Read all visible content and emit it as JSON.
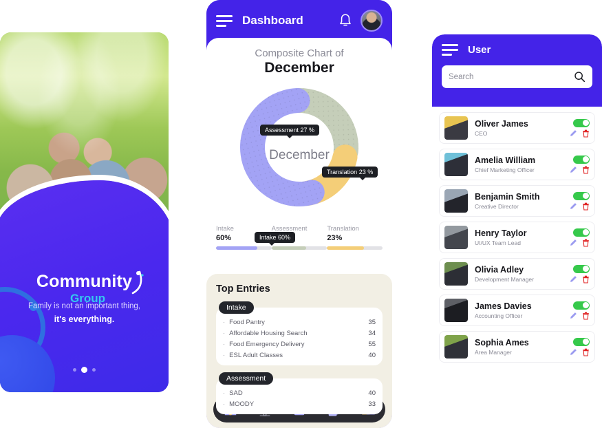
{
  "promo": {
    "brand_line1": "Community",
    "brand_line2": "Group",
    "tagline_1": "Family is not an important thing,",
    "tagline_2": "it's everything.",
    "photo_alt": "family-photo",
    "dots": [
      "inactive",
      "active",
      "inactive"
    ],
    "accent_purple": "#4A2AEF",
    "accent_cyan": "#35C8F0"
  },
  "dashboard": {
    "header": {
      "menu_icon": "hamburger-icon",
      "title": "Dashboard",
      "bell_icon": "notification-bell-icon",
      "avatar_icon": "user-avatar"
    },
    "chart_title_small": "Composite Chart of",
    "chart_title_large": "December",
    "donut_center": "December",
    "tooltips": [
      {
        "id": "assessment",
        "text": "Assessment  27 %"
      },
      {
        "id": "translation",
        "text": "Translation  23 %"
      },
      {
        "id": "intake",
        "text": "Intake  60%"
      }
    ],
    "legend": [
      {
        "name": "Intake",
        "value": "60%",
        "pct": 60,
        "color": "#A3A3F5"
      },
      {
        "name": "Assessment",
        "value": "27%",
        "pct": 62,
        "color": "#C5CEB9"
      },
      {
        "name": "Translation",
        "value": "23%",
        "pct": 66,
        "color": "#F4CE78"
      }
    ],
    "entries": {
      "title": "Top Entries",
      "groups": [
        {
          "label": "Intake",
          "rows": [
            {
              "bullet": "·",
              "name": "Food Pantry",
              "value": "35"
            },
            {
              "bullet": "·",
              "name": "Affordable Housing Search",
              "value": "34"
            },
            {
              "bullet": "·",
              "name": "Food Emergency Delivery",
              "value": "55"
            },
            {
              "bullet": "·",
              "name": "ESL Adult Classes",
              "value": "40"
            }
          ]
        },
        {
          "label": "Assessment",
          "rows": [
            {
              "bullet": "·",
              "name": "SAD",
              "value": "40"
            },
            {
              "bullet": "·",
              "name": "MOODY",
              "value": "33"
            }
          ]
        }
      ]
    },
    "bottom_nav": [
      {
        "icon": "home-icon",
        "active": true
      },
      {
        "icon": "tower-icon",
        "active": false
      },
      {
        "icon": "clipboard-list-icon",
        "active": false
      },
      {
        "icon": "report-document-icon",
        "active": false
      },
      {
        "icon": "users-group-icon",
        "active": false
      }
    ]
  },
  "chart_data": {
    "type": "pie",
    "title": "Composite Chart of December",
    "center_label": "December",
    "categories": [
      "Intake",
      "Assessment",
      "Translation"
    ],
    "values": [
      60,
      27,
      23
    ],
    "unit": "%",
    "colors": [
      "#A3A3F5",
      "#C5CEB9",
      "#F4CE78"
    ],
    "legend_position": "bottom",
    "annotations": [
      "Assessment  27 %",
      "Translation  23 %",
      "Intake  60%"
    ],
    "donut": true
  },
  "users": {
    "header": {
      "menu_icon": "hamburger-icon",
      "title": "User"
    },
    "search": {
      "placeholder": "Search",
      "value": "",
      "icon": "search-icon"
    },
    "row_icons": {
      "toggle": "status-toggle",
      "edit": "pencil-edit-icon",
      "delete": "trash-delete-icon"
    },
    "list": [
      {
        "name": "Oliver James",
        "role": "CEO",
        "enabled": true
      },
      {
        "name": "Amelia William",
        "role": "Chief Marketing Officer",
        "enabled": true
      },
      {
        "name": "Benjamin Smith",
        "role": "Creative Director",
        "enabled": true
      },
      {
        "name": "Henry Taylor",
        "role": "UI/UX Team Lead",
        "enabled": true
      },
      {
        "name": "Olivia Adley",
        "role": "Development Manager",
        "enabled": true
      },
      {
        "name": "James Davies",
        "role": "Accounting Officer",
        "enabled": true
      },
      {
        "name": "Sophia Ames",
        "role": "Area Manager",
        "enabled": true
      }
    ]
  }
}
